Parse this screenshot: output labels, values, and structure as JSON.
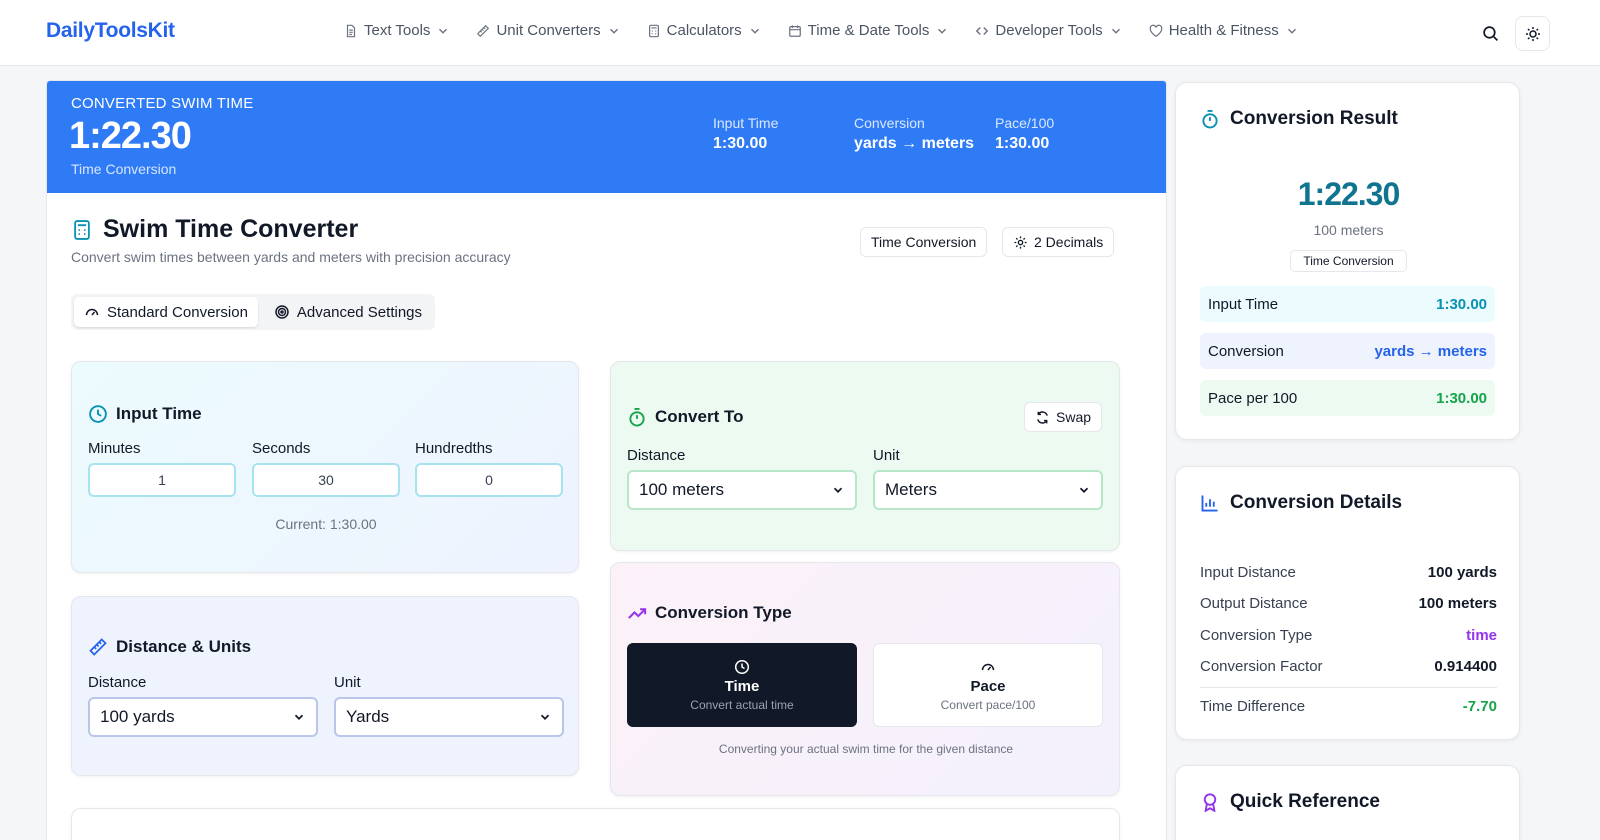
{
  "header": {
    "logo": "DailyToolsKit",
    "nav": [
      {
        "label": "Text Tools",
        "icon": "document-icon"
      },
      {
        "label": "Unit Converters",
        "icon": "ruler-icon"
      },
      {
        "label": "Calculators",
        "icon": "calculator-icon"
      },
      {
        "label": "Time & Date Tools",
        "icon": "calendar-icon"
      },
      {
        "label": "Developer Tools",
        "icon": "code-icon"
      },
      {
        "label": "Health & Fitness",
        "icon": "heart-icon"
      }
    ]
  },
  "hero": {
    "label": "CONVERTED SWIM TIME",
    "value": "1:22.30",
    "sub": "Time Conversion",
    "stats": [
      {
        "label": "Input Time",
        "value": "1:30.00"
      },
      {
        "label": "Conversion",
        "value": "yards → meters"
      },
      {
        "label": "Pace/100",
        "value": "1:30.00"
      }
    ]
  },
  "converter": {
    "title": "Swim Time Converter",
    "subtitle": "Convert swim times between yards and meters with precision accuracy",
    "badge_type": "Time Conversion",
    "badge_decimals": "2 Decimals",
    "tabs": [
      "Standard Conversion",
      "Advanced Settings"
    ],
    "input_time": {
      "title": "Input Time",
      "minutes_label": "Minutes",
      "seconds_label": "Seconds",
      "hundredths_label": "Hundredths",
      "minutes": "1",
      "seconds": "30",
      "hundredths": "0",
      "current": "Current: 1:30.00"
    },
    "convert_to": {
      "title": "Convert To",
      "swap": "Swap",
      "distance_label": "Distance",
      "unit_label": "Unit",
      "distance": "100 meters",
      "unit": "Meters"
    },
    "distance_units": {
      "title": "Distance & Units",
      "distance_label": "Distance",
      "unit_label": "Unit",
      "distance": "100 yards",
      "unit": "Yards"
    },
    "conversion_type": {
      "title": "Conversion Type",
      "time_title": "Time",
      "time_desc": "Convert actual time",
      "pace_title": "Pace",
      "pace_desc": "Convert pace/100",
      "note": "Converting your actual swim time for the given distance"
    }
  },
  "result": {
    "title": "Conversion Result",
    "value": "1:22.30",
    "distance": "100 meters",
    "badge": "Time Conversion",
    "rows": [
      {
        "label": "Input Time",
        "value": "1:30.00"
      },
      {
        "label": "Conversion",
        "value": "yards → meters"
      },
      {
        "label": "Pace per 100",
        "value": "1:30.00"
      }
    ]
  },
  "details": {
    "title": "Conversion Details",
    "rows": [
      {
        "label": "Input Distance",
        "value": "100 yards"
      },
      {
        "label": "Output Distance",
        "value": "100 meters"
      },
      {
        "label": "Conversion Type",
        "value": "time"
      },
      {
        "label": "Conversion Factor",
        "value": "0.914400"
      },
      {
        "label": "Time Difference",
        "value": "-7.70"
      }
    ]
  },
  "reference": {
    "title": "Quick Reference"
  },
  "colors": {
    "brand": "#2563eb",
    "hero": "#2f7bf6",
    "accent_teal": "#0891b2",
    "accent_green": "#16a34a",
    "accent_purple": "#9333ea",
    "dark_button": "#111827"
  }
}
